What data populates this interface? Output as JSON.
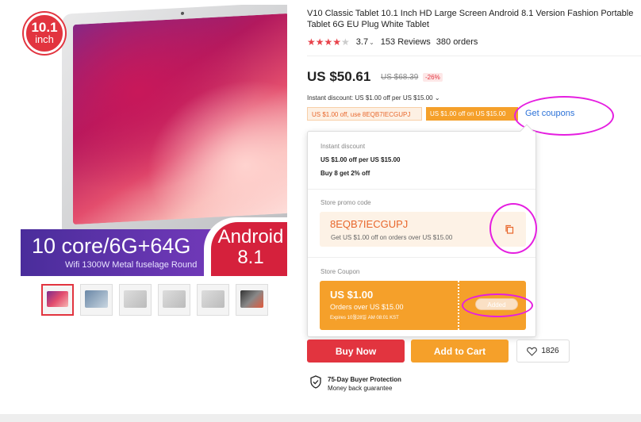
{
  "product": {
    "title": "V10 Classic Tablet 10.1 Inch HD Large Screen Android 8.1 Version Fashion Portable Tablet 6G EU Plug White Tablet",
    "rating": "3.7",
    "reviews": "153 Reviews",
    "orders": "380 orders",
    "price": "US $50.61",
    "old_price": "US $68.39",
    "discount": "-26%"
  },
  "image": {
    "badge_size": "10.1",
    "badge_unit": "inch",
    "spec_main": "10 core/6G+64G",
    "spec_sub": "Wifi 1300W Metal fuselage Round",
    "android_label": "Android",
    "android_version": "8.1",
    "thumb_count": 6
  },
  "discounts": {
    "instant_line": "Instant discount: US $1.00 off per US $15.00",
    "tag1": "US $1.00 off, use 8EQB7IECGUPJ",
    "tag2": "US $1.00 off on US $15.00",
    "get_coupons": "Get coupons"
  },
  "popup": {
    "instant_label": "Instant discount",
    "instant_line1": "US $1.00 off per US $15.00",
    "instant_line2": "Buy 8 get 2% off",
    "promo_label": "Store promo code",
    "promo_code": "8EQB7IECGUPJ",
    "promo_desc": "Get US $1.00 off on orders over US $15.00",
    "coupon_label": "Store Coupon",
    "coupon_amount": "US $1.00",
    "coupon_condition": "Orders over US $15.00",
    "coupon_expiry": "Expires 10월28일 AM 08:01 KST",
    "added_label": "Added"
  },
  "actions": {
    "buy_now": "Buy Now",
    "add_to_cart": "Add to Cart",
    "wishlist_count": "1826"
  },
  "protection": {
    "title": "75-Day Buyer Protection",
    "subtitle": "Money back guarantee"
  },
  "colors": {
    "accent_red": "#e2343f",
    "accent_orange": "#f5a02a",
    "link_blue": "#2c72d8",
    "highlight_ring": "#e51ee0"
  }
}
